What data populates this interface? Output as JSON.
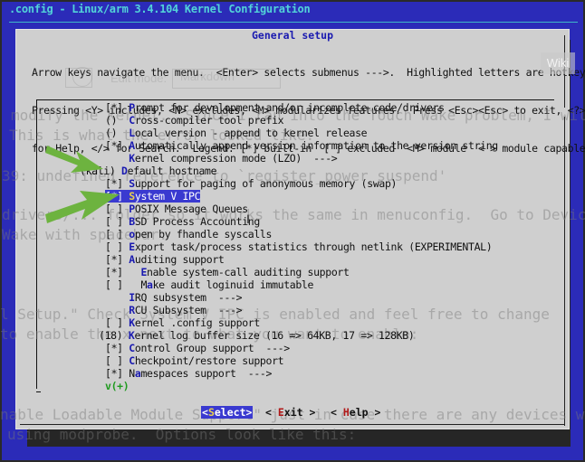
{
  "window": {
    "title": ".config - Linux/arm 3.4.104 Kernel Configuration"
  },
  "dialog": {
    "title": "General setup",
    "help_lines": [
      "Arrow keys navigate the menu.  <Enter> selects submenus --->.  Highlighted letters are hotkeys.",
      "Pressing <Y> includes, <N> excludes, <M> modularizes features.  Press <Esc><Esc> to exit, <?>",
      "for Help, </> for Search.  Legend: [*] built-in  [ ] excluded  <M> module  < > module capable"
    ],
    "items": [
      {
        "prefix": "[*] ",
        "hotkey": "P",
        "rest": "rompt for development and/or incomplete code/drivers",
        "selected": false
      },
      {
        "prefix": "()  ",
        "hotkey": "C",
        "rest": "ross-compiler tool prefix",
        "selected": false
      },
      {
        "prefix": "()  ",
        "hotkey": "L",
        "rest": "ocal version - append to kernel release",
        "selected": false
      },
      {
        "prefix": "[*] ",
        "hotkey": "A",
        "rest": "utomatically append version information to the version string",
        "selected": false
      },
      {
        "prefix": "    ",
        "hotkey": "K",
        "rest": "ernel compression mode (LZO)  --->",
        "selected": false
      },
      {
        "prefix": "(kali) ",
        "hotkey": "D",
        "rest": "efault hostname",
        "selected": false
      },
      {
        "prefix": "[*] ",
        "hotkey": "S",
        "rest": "upport for paging of anonymous memory (swap)",
        "selected": false
      },
      {
        "prefix": "[*] ",
        "hotkey": "S",
        "rest": "ystem V IPC",
        "selected": true
      },
      {
        "prefix": "[ ] ",
        "hotkey": "P",
        "rest": "OSIX Message Queues",
        "selected": false
      },
      {
        "prefix": "[ ] ",
        "hotkey": "B",
        "rest": "SD Process Accounting",
        "selected": false
      },
      {
        "prefix": "[ ] ",
        "hotkey": "o",
        "rest": "pen by fhandle syscalls",
        "selected": false
      },
      {
        "prefix": "[ ] ",
        "hotkey": "E",
        "rest": "xport task/process statistics through netlink (EXPERIMENTAL)",
        "selected": false
      },
      {
        "prefix": "[*] ",
        "hotkey": "A",
        "rest": "uditing support",
        "selected": false
      },
      {
        "prefix": "[*]   ",
        "hotkey": "E",
        "rest": "nable system-call auditing support",
        "selected": false
      },
      {
        "prefix": "[ ]   M",
        "hotkey": "a",
        "rest": "ke audit loginuid immutable",
        "selected": false
      },
      {
        "prefix": "    ",
        "hotkey": "I",
        "rest": "RQ subsystem  --->",
        "selected": false
      },
      {
        "prefix": "    ",
        "hotkey": "R",
        "rest": "CU Subsystem  --->",
        "selected": false
      },
      {
        "prefix": "[ ] ",
        "hotkey": "K",
        "rest": "ernel .config support",
        "selected": false
      },
      {
        "prefix": "(18) ",
        "hotkey": "K",
        "rest": "ernel log buffer size (16 => 64KB, 17 => 128KB)",
        "selected": false
      },
      {
        "prefix": "[*] ",
        "hotkey": "C",
        "rest": "ontrol Group support  --->",
        "selected": false
      },
      {
        "prefix": "[ ] ",
        "hotkey": "C",
        "rest": "heckpoint/restore support",
        "selected": false
      },
      {
        "prefix": "[*] N",
        "hotkey": "a",
        "rest": "mespaces support  --->",
        "selected": false
      }
    ],
    "more_indicator": "v(+)",
    "buttons": {
      "select": {
        "open": "<",
        "hotkey": "S",
        "rest": "elect",
        "close": ">"
      },
      "exit": {
        "open": "< ",
        "hotkey": "E",
        "rest": "xit",
        "close": " >"
      },
      "help": {
        "open": "< ",
        "hotkey": "H",
        "rest": "elp",
        "close": " >"
      }
    }
  },
  "background_ghost": {
    "toolbar": {
      "edit_mode_label": "Edit mode:",
      "edit_mode_value": "Markdown",
      "wiki_button": "Wiki"
    },
    "text_lines": [
      "modify the kernel.  Since I ran into the Touch Wake problem, I will",
      "This is what the error looked like:",
      "39: undefined reference to `register_power_suspend'",
      "drivers/... folder so it works the same in menuconfig.  Go to Device",
      "Wake with spacebar:",
      "l Setup.\" Check System V IPC is enabled and feel free to change",
      "to enable the x next to what you want to enable:",
      "nable Loadable Module Support\" just in case there are any devices we",
      "using modprobe.  Options look like this:"
    ]
  },
  "colors": {
    "frame_blue": "#2b2bb8",
    "title_cyan": "#52d3d8",
    "dialog_gray": "#cfcfcf",
    "hotkey_blue": "#1a1ab0",
    "selection_blue": "#3a3ad0",
    "selected_hotkey_yellow": "#e8d04c",
    "more_green": "#1f9a1f",
    "button_hotkey_red": "#b01818",
    "annotation_arrow_green": "#6db33f"
  }
}
